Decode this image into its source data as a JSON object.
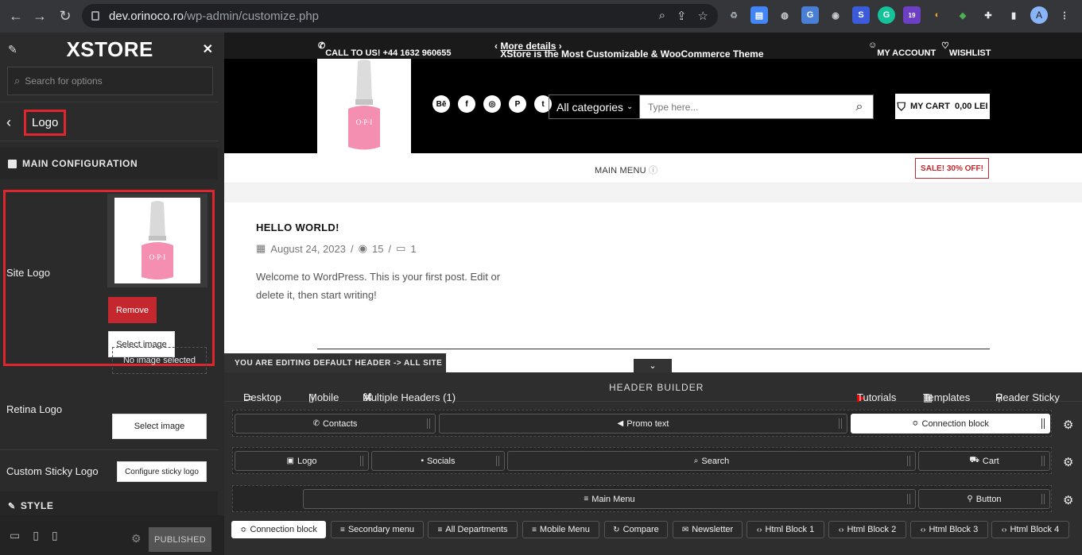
{
  "browser": {
    "url_host": "dev.orinoco.ro",
    "url_path": "/wp-admin/customize.php",
    "profile_initial": "A",
    "ext_badge": "19"
  },
  "sidebar": {
    "brand": "XSTORE",
    "search_placeholder": "Search for options",
    "section_title": "Logo",
    "main_config": "MAIN CONFIGURATION",
    "site_logo_label": "Site Logo",
    "remove_label": "Remove",
    "select_image_label": "Select image",
    "retina_logo_label": "Retina Logo",
    "no_image_label": "No image selected",
    "retina_select_label": "Select image",
    "sticky_logo_label": "Custom Sticky Logo",
    "configure_sticky_label": "Configure sticky logo",
    "style_label": "STYLE",
    "published_label": "PUBLISHED"
  },
  "preview": {
    "topbar": {
      "call": "CALL TO US! +44 1632 960655",
      "promo": "XStore is the Most Customizable & WooCommerce Theme",
      "promo_link": "More details",
      "account": "MY ACCOUNT",
      "wishlist": "WISHLIST"
    },
    "search": {
      "category": "All categories",
      "placeholder": "Type here..."
    },
    "cart": {
      "label": "MY CART",
      "amount": "0,00 LEI"
    },
    "main_menu": "MAIN MENU",
    "sale": "SALE! 30% OFF!",
    "post": {
      "title": "HELLO WORLD!",
      "date": "August 24, 2023",
      "views": "15",
      "comments": "1",
      "body": "Welcome to WordPress. This is your first post. Edit or delete it, then start writing!"
    },
    "editing_notice": "YOU ARE EDITING DEFAULT HEADER -> ALL SITE"
  },
  "builder": {
    "desktop": "Desktop",
    "mobile": "Mobile",
    "multiple_headers": "Multiple Headers (1)",
    "title": "HEADER BUILDER",
    "tutorials": "Tutorials",
    "templates": "Templates",
    "header_sticky": "Header Sticky",
    "row1": [
      "Contacts",
      "Promo text",
      "Connection block"
    ],
    "row2": [
      "Logo",
      "Socials",
      "Search",
      "Cart"
    ],
    "row3": [
      "Main Menu",
      "Button"
    ],
    "available": [
      "Connection block",
      "Secondary menu",
      "All Departments",
      "Mobile Menu",
      "Compare",
      "Newsletter",
      "Html Block 1",
      "Html Block 2",
      "Html Block 3",
      "Html Block 4"
    ]
  },
  "colors": {
    "accent_red": "#e0262d",
    "remove_red": "#c4272d",
    "sidebar_bg": "#2b2b2b"
  }
}
